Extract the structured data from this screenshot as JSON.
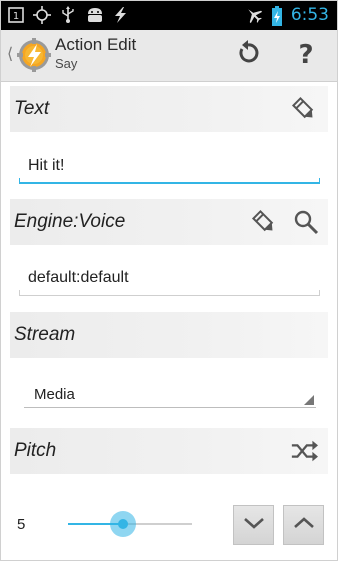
{
  "status_bar": {
    "time": "6:53",
    "left_icons": [
      "notification-square-icon",
      "gps-icon",
      "usb-icon",
      "android-icon",
      "flash-icon"
    ],
    "right_icons": [
      "airplane-icon",
      "battery-charging-icon"
    ]
  },
  "action_bar": {
    "title": "Action Edit",
    "subtitle": "Say",
    "buttons": [
      "undo-icon",
      "help-icon"
    ],
    "help_glyph": "?"
  },
  "sections": {
    "text": {
      "label": "Text",
      "value": "Hit it!"
    },
    "engine": {
      "label": "Engine:Voice",
      "value": "default:default"
    },
    "stream": {
      "label": "Stream",
      "selected": "Media"
    },
    "pitch": {
      "label": "Pitch",
      "value": "5",
      "level_fraction": 0.44
    }
  },
  "colors": {
    "accent": "#33b5e5",
    "status_bar": "#000000",
    "action_bar": "#e9e9e9"
  }
}
